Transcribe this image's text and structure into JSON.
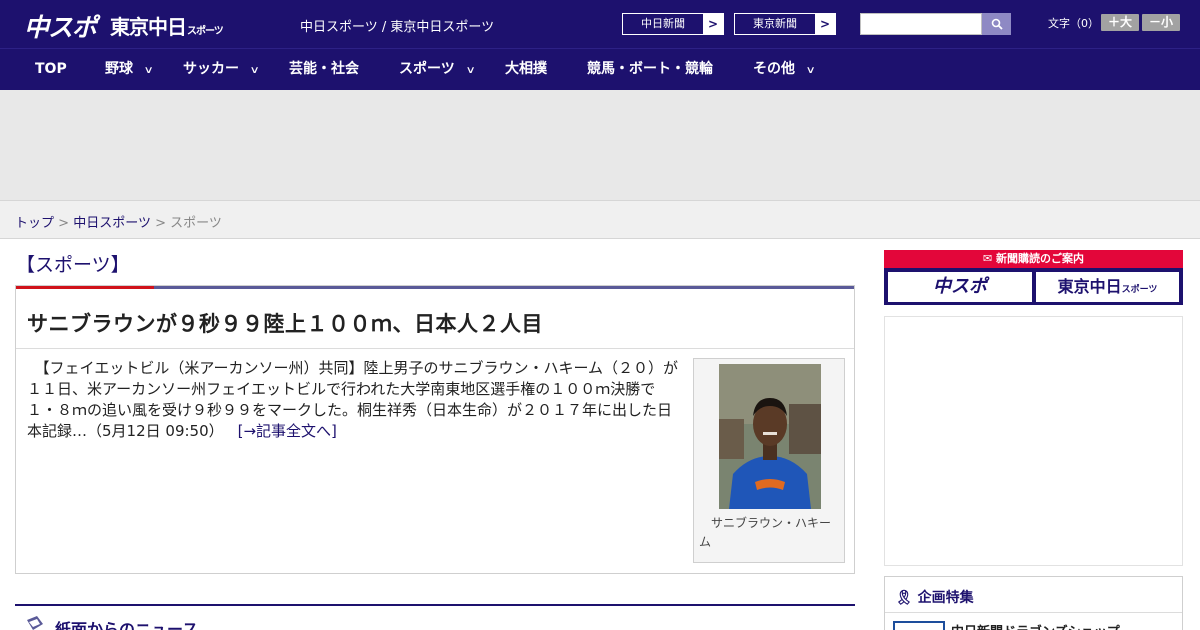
{
  "header": {
    "logo_main": "中スポ",
    "logo_tokyo": "東京中日",
    "logo_tokyo_small": "スポーツ",
    "site_title": "中日スポーツ / 東京中日スポーツ",
    "paper_buttons": [
      "中日新聞",
      "東京新聞"
    ],
    "search": {
      "placeholder": "",
      "icon": "search-icon"
    },
    "font_size": {
      "label": "文字（0）",
      "larger": "＋大",
      "smaller": "－小"
    }
  },
  "nav": {
    "items": [
      {
        "label": "TOP"
      },
      {
        "label": "野球",
        "dropdown": true
      },
      {
        "label": "サッカー",
        "dropdown": true
      },
      {
        "label": "芸能・社会"
      },
      {
        "label": "スポーツ",
        "dropdown": true
      },
      {
        "label": "大相撲"
      },
      {
        "label": "競馬・ボート・競輪"
      },
      {
        "label": "その他",
        "dropdown": true
      }
    ]
  },
  "breadcrumb": {
    "home": "トップ",
    "parent": "中日スポーツ",
    "current": "スポーツ",
    "separator": ">"
  },
  "section": {
    "title": "【スポーツ】"
  },
  "article": {
    "headline": "サニブラウンが９秒９９陸上１００ｍ、日本人２人目",
    "lead": "　【フェイエットビル（米アーカンソー州）共同】陸上男子のサニブラウン・ハキーム（２０）が１１日、米アーカンソー州フェイエットビルで行われた大学南東地区選手権の１００ｍ決勝で１・８ｍの追い風を受け９秒９９をマークした。桐生祥秀（日本生命）が２０１７年に出した日本記録…（5月12日 09:50）",
    "more_link": "[→記事全文へ]",
    "photo_caption": "サニブラウン・ハキーム"
  },
  "news_section": {
    "title": "紙面からのニュース"
  },
  "sidebar": {
    "subscription": {
      "heading": "新聞購読のご案内",
      "logos": [
        "中スポ",
        "東京中日"
      ],
      "logo_small": "スポーツ"
    },
    "feature": {
      "title": "企画特集",
      "item": "中日新聞ドラゴンズショップ"
    }
  },
  "colors": {
    "brand_navy": "#1d116e",
    "accent_red": "#d0121b",
    "subscription_red": "#e3063a"
  }
}
